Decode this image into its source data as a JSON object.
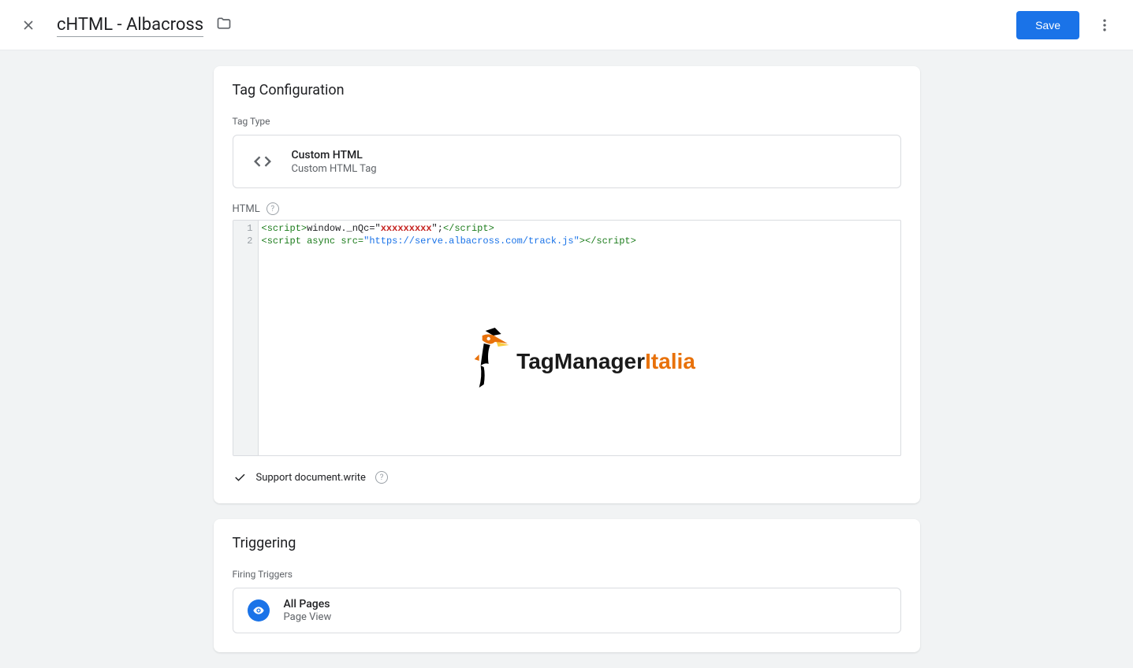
{
  "header": {
    "tag_name": "cHTML - Albacross",
    "save_label": "Save"
  },
  "config": {
    "section_title": "Tag Configuration",
    "type_label": "Tag Type",
    "type_name": "Custom HTML",
    "type_subtitle": "Custom HTML Tag",
    "html_label": "HTML",
    "code": {
      "line1": {
        "open_tag": "<script>",
        "pre": "window._nQc=",
        "quote1": "\"",
        "value": "xxxxxxxxx",
        "quote2": "\"",
        "post": ";",
        "close_tag": "</script>"
      },
      "line2": {
        "open": "<script ",
        "async": "async",
        "src_attr": " src=",
        "quote1": "\"",
        "url": "https://serve.albacross.com/track.js",
        "quote2": "\"",
        "mid": ">",
        "close_tag": "</script>"
      }
    },
    "support_label": "Support document.write",
    "watermark_main": "TagManager",
    "watermark_suffix": "Italia"
  },
  "triggering": {
    "section_title": "Triggering",
    "firing_label": "Firing Triggers",
    "trigger_name": "All Pages",
    "trigger_type": "Page View"
  }
}
